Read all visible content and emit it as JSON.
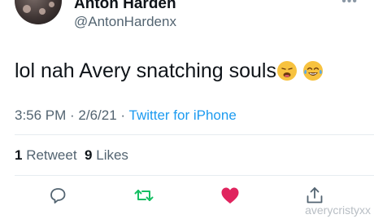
{
  "author": {
    "display_name": "Anton Harden",
    "handle": "@AntonHardenx"
  },
  "tweet": {
    "text": "lol nah Avery snatching souls",
    "emojis": [
      "weary-face-emoji",
      "tears-of-joy-emoji"
    ]
  },
  "meta": {
    "time": "3:56 PM",
    "separator1": " · ",
    "date": "2/6/21",
    "separator2": " · ",
    "source": "Twitter for iPhone"
  },
  "stats": {
    "retweets_count": "1",
    "retweets_label": "Retweet",
    "likes_count": "9",
    "likes_label": "Likes"
  },
  "actions": {
    "reply_icon": "reply-icon",
    "retweet_icon": "retweet-icon",
    "like_icon": "heart-icon",
    "share_icon": "share-icon"
  },
  "colors": {
    "retweet": "#17bf63",
    "like": "#e0245e",
    "link": "#1d9bf0",
    "secondary_text": "#536471"
  },
  "watermark": "averycristyxx"
}
